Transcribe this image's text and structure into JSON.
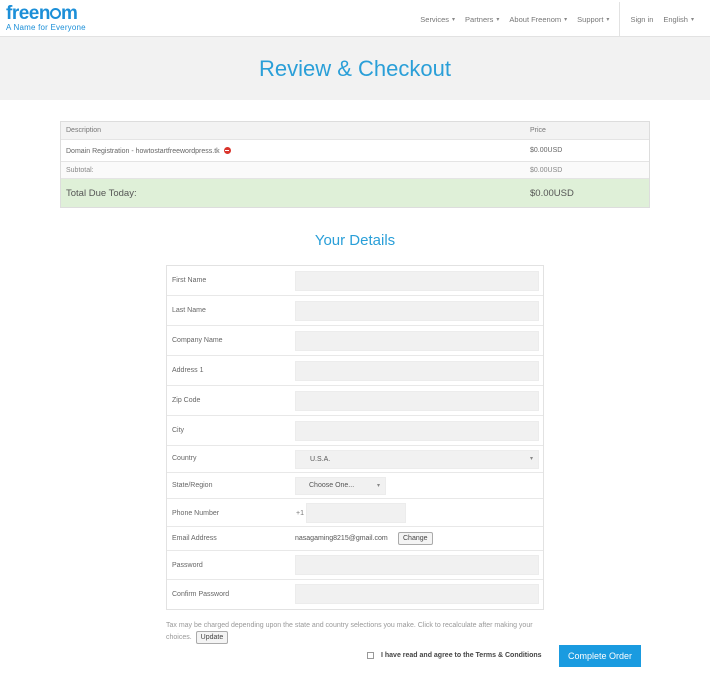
{
  "header": {
    "logo_word_pre": "freen",
    "logo_word_post": "m",
    "tagline": "A Name for Everyone",
    "nav": [
      {
        "label": "Services",
        "caret": "▾"
      },
      {
        "label": "Partners",
        "caret": "▾"
      },
      {
        "label": "About Freenom",
        "caret": "▾"
      },
      {
        "label": "Support",
        "caret": "▾"
      }
    ],
    "sign_in": "Sign in",
    "language": "English",
    "language_caret": "▾"
  },
  "page_title": "Review & Checkout",
  "order": {
    "headers": [
      "Description",
      "Price"
    ],
    "item": {
      "description": "Domain Registration - howtostartfreewordpress.tk",
      "price": "$0.00USD"
    },
    "subtotal": {
      "label": "Subtotal:",
      "value": "$0.00USD"
    },
    "total": {
      "label": "Total Due Today:",
      "value": "$0.00USD"
    }
  },
  "details_title": "Your Details",
  "form": {
    "first_name": "First Name",
    "last_name": "Last Name",
    "company_name": "Company Name",
    "address1": "Address 1",
    "zip": "Zip Code",
    "city": "City",
    "country_label": "Country",
    "country_value": "U.S.A.",
    "state_label": "State/Region",
    "state_value": "Choose One...",
    "phone_label": "Phone Number",
    "phone_prefix": "+1",
    "email_label": "Email Address",
    "email_value": "nasagaming8215@gmail.com",
    "change_label": "Change",
    "password": "Password",
    "confirm_password": "Confirm Password",
    "select_caret": "▾"
  },
  "tax_note": "Tax may be charged depending upon the state and country selections you make. Click to recalculate after making your choices.",
  "update_label": "Update",
  "agree_prefix": "I have read and agree to the",
  "terms_label": "Terms & Conditions",
  "complete_label": "Complete Order",
  "colors": {
    "accent": "#1a9be0",
    "title": "#2a9fd8",
    "total_bg": "#dff0d8",
    "remove": "#d9342b"
  }
}
